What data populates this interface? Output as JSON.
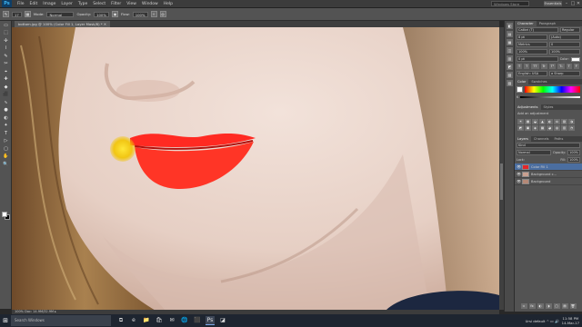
{
  "app": {
    "logo": "Ps",
    "menu": [
      "File",
      "Edit",
      "Image",
      "Layer",
      "Type",
      "Select",
      "Filter",
      "View",
      "Window",
      "Help"
    ],
    "search_placeholder": "Windows Store",
    "workspace": "Essentials",
    "window_buttons": [
      "–",
      "□",
      "✕"
    ]
  },
  "options": {
    "brush_size": "17",
    "mode_label": "Mode:",
    "mode_value": "Normal",
    "opacity_label": "Opacity:",
    "opacity_value": "100%",
    "flow_label": "Flow:",
    "flow_value": "100%"
  },
  "tools": [
    "▭",
    "⬚",
    "✣",
    "⌇",
    "✎",
    "✂",
    "⌖",
    "✚",
    "◆",
    "⬛",
    "∿",
    "●",
    "◐",
    "✦",
    "T",
    "▷",
    "▢",
    "✋",
    "🔍"
  ],
  "document": {
    "tab_title": "bottom.jpg @ 100% (Color Fill 1, Layer Mask/8) *",
    "close": "✕",
    "status": "100%   Doc: 14.9M/32.9M   ▸"
  },
  "strip_icons": [
    "◧",
    "▤",
    "▦",
    "◫",
    "▥",
    "◩",
    "▧",
    "▨"
  ],
  "panels": {
    "character": {
      "tabs": [
        "Character",
        "Paragraph"
      ],
      "font": "Calibri (T)",
      "style": "Regular",
      "size": "8 pt",
      "leading": "(Auto)",
      "kerning": "Metrics",
      "tracking": "0",
      "vscale": "100%",
      "hscale": "100%",
      "baseline": "0 pt",
      "color_label": "Color:",
      "style_buttons": [
        "T",
        "T",
        "TT",
        "Tr",
        "T¹",
        "T₁",
        "T",
        "Ŧ"
      ],
      "language": "English: USA",
      "aa_mode": "a  Sharp"
    },
    "color": {
      "tabs": [
        "Color",
        "Swatches"
      ],
      "channel": "K"
    },
    "adjustments": {
      "tabs": [
        "Adjustments",
        "Styles"
      ],
      "title": "Add an adjustment",
      "icons": [
        "☀",
        "▦",
        "◒",
        "▲",
        "◐",
        "⚖",
        "▨",
        "◑",
        "◩",
        "▣",
        "◈",
        "▩",
        "◕",
        "◍",
        "▥",
        "◔"
      ]
    },
    "layers": {
      "tabs": [
        "Layers",
        "Channels",
        "Paths"
      ],
      "kind_label": "Kind",
      "blend_mode": "Normal",
      "opacity_label": "Opacity:",
      "opacity_value": "100%",
      "lock_label": "Lock:",
      "fill_label": "Fill:",
      "fill_value": "100%",
      "items": [
        {
          "name": "Color Fill 1",
          "thumb": "#e3262b",
          "selected": true
        },
        {
          "name": "Background c...",
          "thumb": "#c9a090",
          "selected": false
        },
        {
          "name": "Background",
          "thumb": "#b58977",
          "selected": false
        }
      ],
      "footer_icons": [
        "∞",
        "fx",
        "◐",
        "◑",
        "▢",
        "▤",
        "🗑"
      ]
    }
  },
  "taskbar": {
    "search_placeholder": "Search Windows",
    "icons": [
      "⧉",
      "e",
      "📁",
      "🛍",
      "✉",
      "🌐",
      "⬛",
      "Ps",
      "◪"
    ],
    "active_index": 7,
    "tray": "Ursi default  ^  ▭  🔊",
    "time": "11:58 PM",
    "date": "14-Mar-17"
  },
  "colors": {
    "lip_red": "#ff2a22",
    "brush_cursor": "#f5d300",
    "accent": "#4b6ea0"
  }
}
